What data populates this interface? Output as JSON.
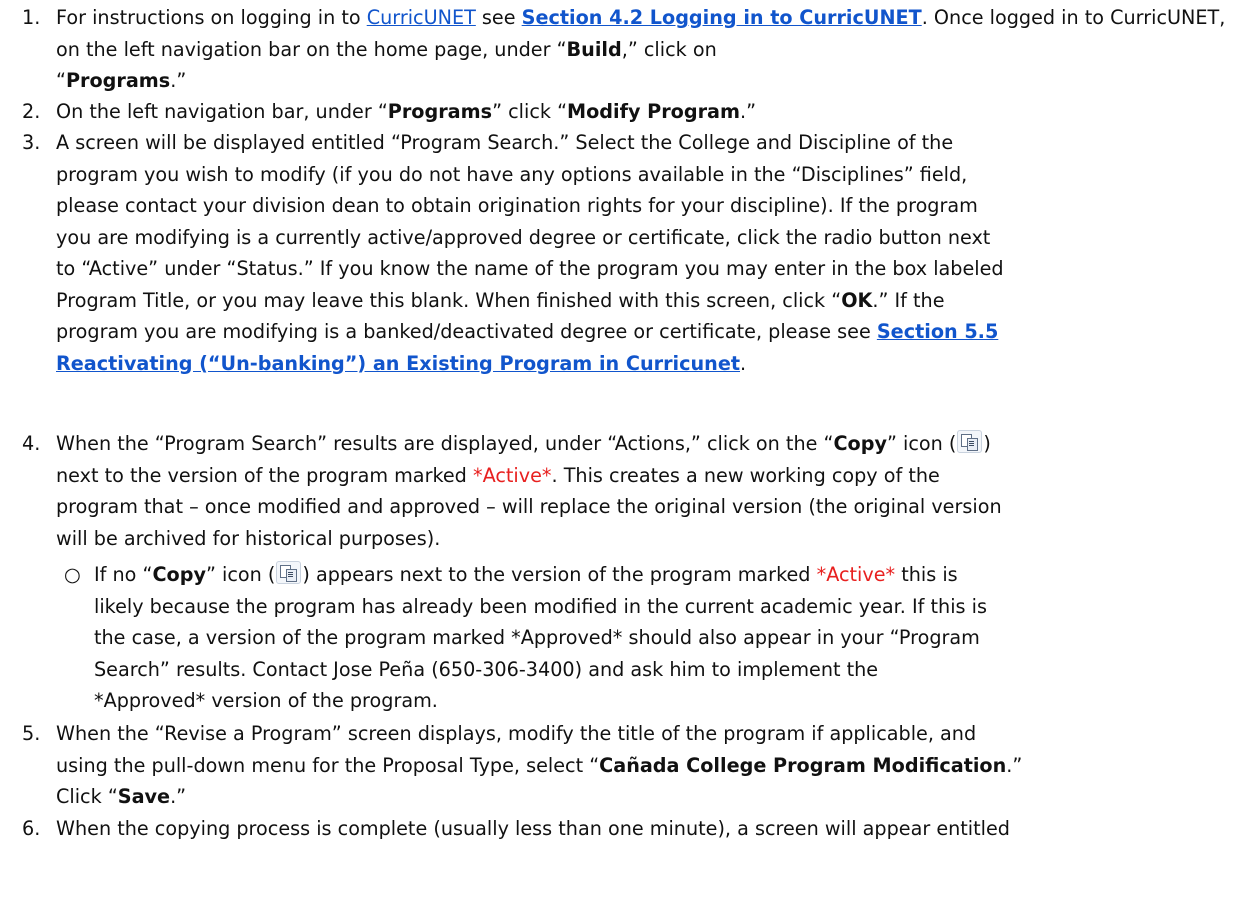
{
  "steps": [
    {
      "number": "1.",
      "t1": "For instructions on logging in to ",
      "link1": "CurricUNET",
      "t2": " see ",
      "link2": "Section 4.2 Logging in to CurricUNET",
      "t3": ".  Once logged in to CurricUNET, on the left navigation bar on the home page, under “",
      "b1": "Build",
      "t4": ",” click on\n“",
      "b2": "Programs",
      "t5": ".”"
    },
    {
      "number": "2.",
      "t1": "On the left navigation bar, under “",
      "b1": "Programs",
      "t2": "” click “",
      "b2": "Modify Program",
      "t3": ".”"
    },
    {
      "number": "3.",
      "t1": "A screen will be displayed entitled “Program Search.” Select the College and Discipline of the\nprogram you wish to modify (if you do not have any options available in the “Disciplines” field,\nplease contact your division dean to obtain origination rights for your discipline).  If the program\nyou are modifying is a currently active/approved degree or certificate, click the radio button next\nto “Active” under “Status.” If you know the name of the program you may enter in the box labeled\nProgram Title, or you may leave this blank.  When finished with this screen, click “",
      "b1": "OK",
      "t2": ".”  If the\nprogram you are modifying is a banked/deactivated degree or certificate, please see ",
      "link1": "Section 5.5\nReactivating (“Un-banking”) an Existing Program in Curricunet",
      "t3": "."
    },
    {
      "number": "4.",
      "t1": "When the “Program Search” results are displayed, under “Actions,” click on the “",
      "b1": "Copy",
      "t2": "” icon (",
      "icon": "copy-icon",
      "t3": ")\nnext to the version of the program marked ",
      "red1": "*Active*",
      "t4": ". This creates a new working copy of the\nprogram that – once modified and approved – will replace the original version (the original version\nwill be archived for historical purposes)."
    },
    {
      "number": "5.",
      "t1": "When the “Revise a Program” screen displays, modify the title of the program if applicable, and\nusing the pull-down menu for the Proposal Type, select “",
      "b1": "Cañada College Program Modification",
      "t2": ".”\nClick “",
      "b2": "Save",
      "t3": ".”"
    },
    {
      "number": "6.",
      "t1": "When the copying process is complete (usually less than one minute), a screen will appear entitled"
    }
  ],
  "substep": {
    "bullet": "○",
    "t1": "If no “",
    "b1": "Copy",
    "t2": "” icon (",
    "icon": "copy-icon",
    "t3": ") appears next to the version of the program marked ",
    "red1": "*Active*",
    "t4": " this is\nlikely because the program has already been modified in the current academic year.  If this is\nthe case, a version of the program marked *Approved* should also appear in your “Program\nSearch” results.  Contact Jose Peña (650-306-3400) and ask him to implement the\n*Approved* version of the program."
  }
}
